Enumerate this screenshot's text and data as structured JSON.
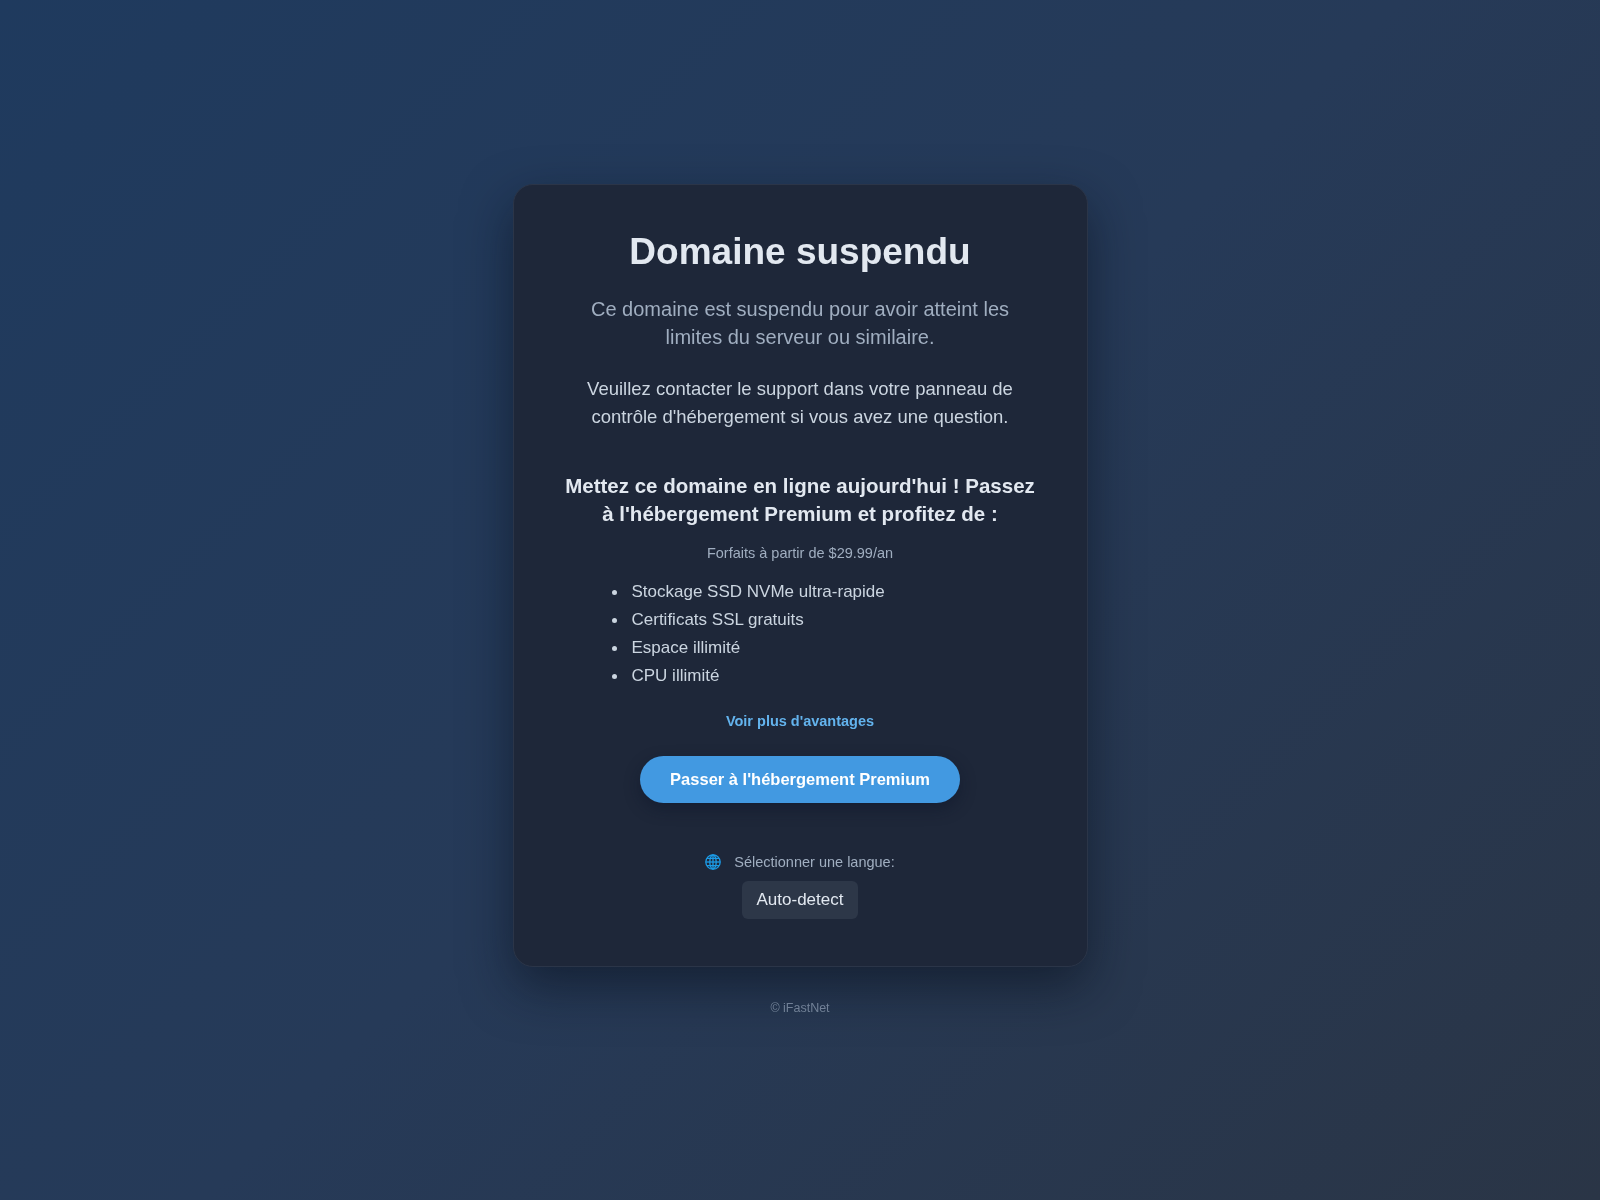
{
  "card": {
    "title": "Domaine suspendu",
    "subtitle": "Ce domaine est suspendu pour avoir atteint les limites du serveur ou similaire.",
    "message": "Veuillez contacter le support dans votre panneau de contrôle d'hébergement si vous avez une question.",
    "promo": {
      "heading": "Mettez ce domaine en ligne aujourd'hui ! Passez à l'hébergement Premium et profitez de :",
      "price_note": "Forfaits à partir de $29.99/an",
      "features": [
        "Stockage SSD NVMe ultra-rapide",
        "Certificats SSL gratuits",
        "Espace illimité",
        "CPU illimité"
      ],
      "link": "Voir plus d'avantages",
      "button": "Passer à l'hébergement Premium"
    },
    "language": {
      "label": "Sélectionner une langue:",
      "value": "Auto-detect"
    }
  },
  "footer": "© iFastNet"
}
